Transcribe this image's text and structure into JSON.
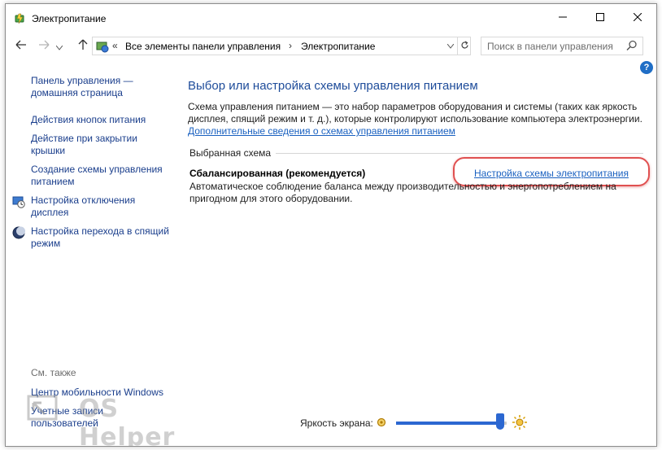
{
  "window": {
    "title": "Электропитание",
    "controls": {
      "minimize": "minimize-icon",
      "maximize": "maximize-icon",
      "close": "close-icon"
    }
  },
  "nav": {
    "back_icon": "arrow-left-icon",
    "forward_icon": "arrow-right-icon",
    "up_icon": "arrow-up-icon",
    "breadcrumb": {
      "overflow": "«",
      "items": [
        "Все элементы панели управления",
        "Электропитание"
      ],
      "separator": "›"
    },
    "search_placeholder": "Поиск в панели управления"
  },
  "sidebar": {
    "items": [
      {
        "label": "Панель управления — домашняя страница",
        "icon": ""
      },
      {
        "label": "Действия кнопок питания",
        "icon": ""
      },
      {
        "label": "Действие при закрытии крышки",
        "icon": ""
      },
      {
        "label": "Создание схемы управления питанием",
        "icon": ""
      },
      {
        "label": "Настройка отключения дисплея",
        "icon": "display-clock-icon"
      },
      {
        "label": "Настройка перехода в спящий режим",
        "icon": "moon-sleep-icon"
      }
    ],
    "see_also": {
      "header": "См. также",
      "items": [
        "Центр мобильности Windows",
        "Учетные записи пользователей"
      ]
    }
  },
  "main": {
    "title": "Выбор или настройка схемы управления питанием",
    "description": "Схема управления питанием — это набор параметров оборудования и системы (таких как яркость дисплея, спящий режим и т. д.), которые контролируют использование компьютера электроэнергии.",
    "description_link": "Дополнительные сведения о схемах управления питанием",
    "group_header": "Выбранная схема",
    "plan": {
      "name": "Сбалансированная (рекомендуется)",
      "link": "Настройка схемы электропитания",
      "description": "Автоматическое соблюдение баланса между производительностью и энергопотреблением на пригодном для этого оборудовании."
    }
  },
  "footer": {
    "brightness_label": "Яркость экрана:",
    "brightness_level": 0.94,
    "watermark": "OS Helper"
  },
  "colors": {
    "link": "#1a61c0",
    "sidebar_link": "#1a3e8c",
    "title": "#1e4c9a",
    "highlight": "#e05050",
    "slider": "#2b67d1"
  }
}
